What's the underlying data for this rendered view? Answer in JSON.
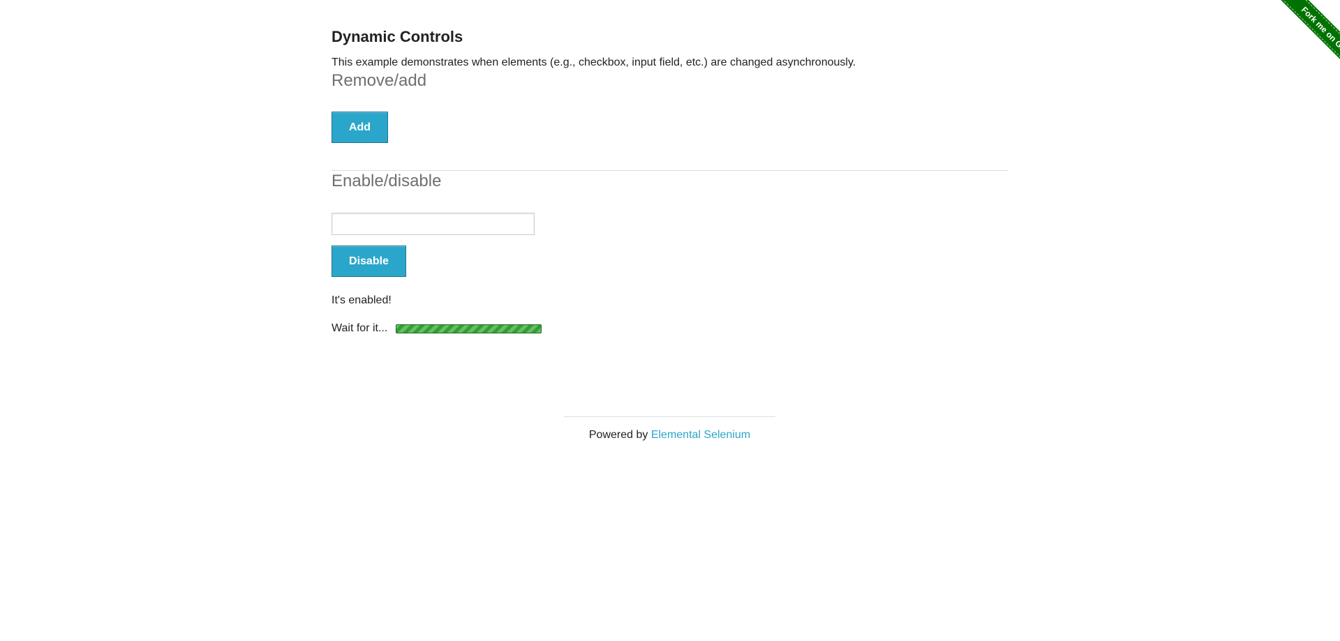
{
  "page": {
    "title": "Dynamic Controls",
    "description": "This example demonstrates when elements (e.g., checkbox, input field, etc.) are changed asynchronously."
  },
  "remove_add": {
    "heading": "Remove/add",
    "button_label": "Add"
  },
  "enable_disable": {
    "heading": "Enable/disable",
    "input_value": "",
    "button_label": "Disable",
    "message": "It's enabled!",
    "loading_text": "Wait for it...",
    "progress_color": "#2fa12f"
  },
  "footer": {
    "prefix": "Powered by ",
    "link_text": "Elemental Selenium"
  },
  "ribbon": {
    "label": "Fork me on GitHub",
    "color": "#007200"
  },
  "colors": {
    "accent": "#2ba6cb",
    "heading_gray": "#6f6f6f"
  }
}
